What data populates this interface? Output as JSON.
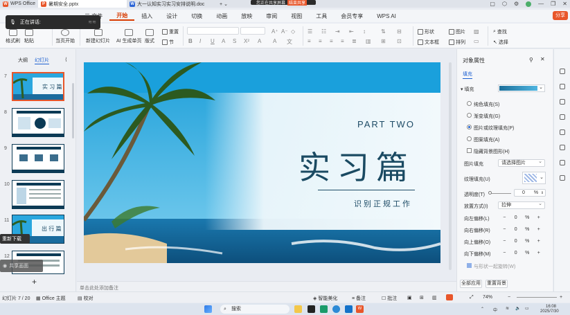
{
  "tabs": [
    {
      "label": "WPS Office",
      "color": "#e8562a",
      "glyph": "W"
    },
    {
      "label": "暑期安全.pptx",
      "color": "#e8562a",
      "glyph": "P"
    },
    {
      "label": "大一认知实习实习安排说明.doc",
      "color": "#2b64d6",
      "glyph": "W"
    }
  ],
  "recording": {
    "banner": "正在讲话:",
    "pill_text": "您正在共享屏幕",
    "pill_action": "结束共享"
  },
  "menu": {
    "file_label": "三 文件",
    "items": [
      "开始",
      "插入",
      "设计",
      "切换",
      "动画",
      "放映",
      "审阅",
      "视图",
      "工具",
      "会员专享",
      "WPS AI"
    ],
    "active": "开始",
    "share": "分享"
  },
  "ribbon": {
    "format_painter": "格式刷",
    "paste": "粘贴",
    "current_start": "当页开始",
    "new_slide": "新建幻灯片",
    "ai_generate": "AI 生成单页",
    "layout": "版式",
    "reset": "重置",
    "section": "节",
    "shape": "形状",
    "image": "图片",
    "textbox": "文本框",
    "arrange": "排列",
    "find": "查找",
    "select": "选择"
  },
  "left_panel": {
    "tab_outline": "大纲",
    "tab_slides": "幻灯片",
    "slide_numbers": [
      "7",
      "8",
      "9",
      "10",
      "11",
      "12"
    ],
    "thumb7_title": "实 习 篇",
    "thumb11_title": "出 行 篇",
    "tip1": "重新下载",
    "tip2": "共享画面"
  },
  "slide": {
    "part": "PART TWO",
    "title": "实习篇",
    "subtitle": "识别正规工作"
  },
  "notes_placeholder": "单击此处添加备注",
  "properties": {
    "title": "对象属性",
    "fill_tab": "填充",
    "fill_section": "填充",
    "options": [
      {
        "label": "纯色填充(S)",
        "on": false
      },
      {
        "label": "渐变填充(G)",
        "on": false
      },
      {
        "label": "图片或纹理填充(P)",
        "on": true
      },
      {
        "label": "图案填充(A)",
        "on": false
      }
    ],
    "hide_bg": "隐藏背景图形(H)",
    "image_fill_label": "图片填充",
    "image_fill_value": "请选择图片",
    "texture_label": "纹理填充(U)",
    "transparency_label": "透明度(T)",
    "transparency_value": "0",
    "transparency_unit": "%",
    "placement_label": "放置方式(I)",
    "placement_value": "拉伸",
    "offsets": [
      {
        "label": "向左偏移(L)",
        "value": "0",
        "unit": "%"
      },
      {
        "label": "向右偏移(R)",
        "value": "0",
        "unit": "%"
      },
      {
        "label": "向上偏移(O)",
        "value": "0",
        "unit": "%"
      },
      {
        "label": "向下偏移(M)",
        "value": "0",
        "unit": "%"
      }
    ],
    "rotate_with": "与形状一起旋转(W)",
    "apply_all": "全部应用",
    "reset_bg": "重置背景"
  },
  "status": {
    "slide_pos": "幻灯片 7 / 20",
    "theme": "Office 主题",
    "proof": "校对",
    "beautify": "智能美化",
    "notes": "备注",
    "comment": "批注",
    "zoom": "74%"
  },
  "taskbar": {
    "search": "搜索",
    "time": "16:08",
    "date": "2025/7/30",
    "lang": "中"
  }
}
